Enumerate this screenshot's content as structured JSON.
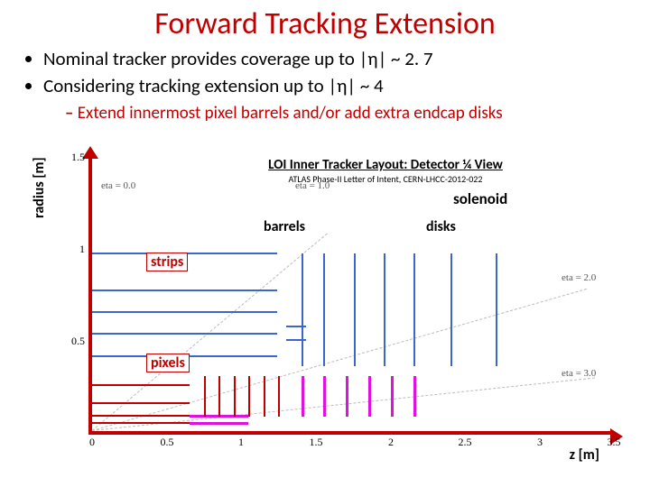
{
  "title": "Forward Tracking Extension",
  "bullets": [
    "Nominal tracker provides coverage up to |η| ~ 2. 7",
    "Considering tracking extension up to |η| ~ 4"
  ],
  "sub_bullet": "Extend innermost pixel barrels and/or add extra endcap disks",
  "ylabel": "radius [m]",
  "xlabel": "z [m]",
  "chart_title": "LOI Inner Tracker Layout: Detector ¼ View",
  "chart_subtitle": "ATLAS Phase-II Letter of Intent, CERN-LHCC-2012-022",
  "solenoid_label": "solenoid",
  "ann_barrels": "barrels",
  "ann_disks": "disks",
  "ann_strips": "strips",
  "ann_pixels": "pixels",
  "eta_labels": [
    "eta = 0.0",
    "eta = 1.0",
    "eta = 2.0",
    "eta = 3.0"
  ],
  "chart_data": {
    "type": "diagram",
    "title": "LOI Inner Tracker Layout: Detector ¼ View",
    "xlabel": "z [m]",
    "ylabel": "radius [m]",
    "xlim": [
      0.0,
      3.5
    ],
    "ylim": [
      0.0,
      1.5
    ],
    "xticks": [
      0.0,
      0.5,
      1.0,
      1.5,
      2.0,
      2.5,
      3.0,
      3.5
    ],
    "yticks": [
      0.5,
      1.0,
      1.5
    ],
    "eta_lines": [
      0.0,
      1.0,
      2.0,
      3.0
    ],
    "strip_barrels": {
      "radii": [
        0.4,
        0.52,
        0.64,
        0.76,
        0.96
      ],
      "z_extent": 1.25
    },
    "strip_disks": {
      "z_positions": [
        1.4,
        1.55,
        1.75,
        1.95,
        2.15,
        2.4,
        2.7
      ],
      "r_range": [
        0.35,
        0.95
      ]
    },
    "pixel_barrels": {
      "radii": [
        0.04,
        0.08,
        0.15,
        0.25
      ],
      "z_extent_nominal": 0.65,
      "z_extent_extended": 1.05
    },
    "pixel_disks": {
      "z_positions_nominal": [
        0.75,
        0.85,
        0.95,
        1.05,
        1.15,
        1.25
      ],
      "z_positions_extended": [
        1.4,
        1.55,
        1.7,
        1.85,
        2.0,
        2.15
      ],
      "r_range": [
        0.08,
        0.3
      ]
    },
    "pixel_extension_color": "#e010e0",
    "strip_color": "#3b66cc",
    "pixel_nominal_color": "#c00000"
  }
}
